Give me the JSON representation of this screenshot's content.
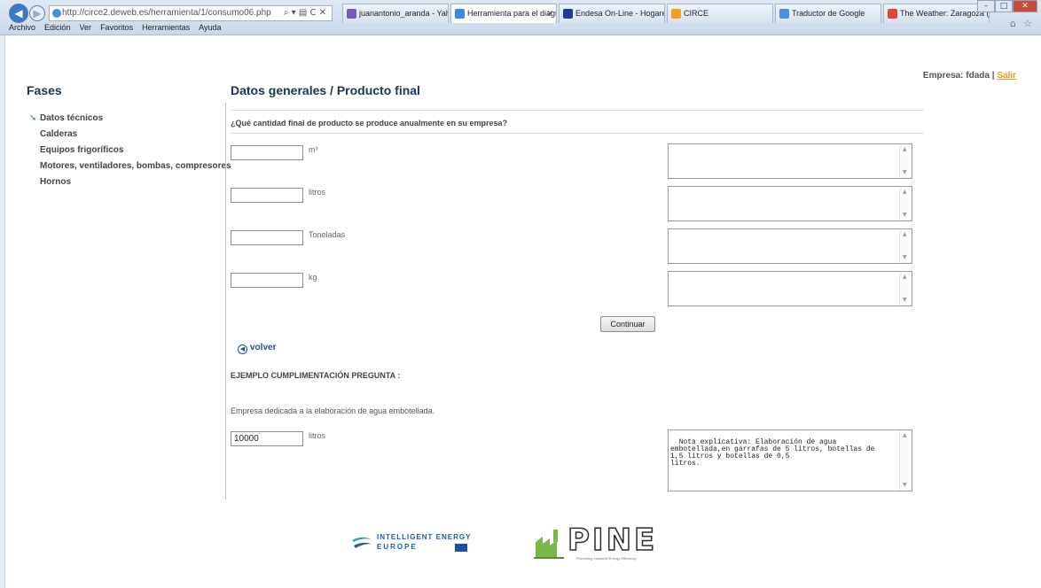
{
  "browser": {
    "url": "http://circe2.deweb.es/herramienta/1/consumo06.php",
    "addr_controls": "⌕ ▾ ▤ C ✕",
    "tabs": [
      {
        "label": "juanantonio_aranda - Yahoo! ...",
        "color": "#7b5bb8"
      },
      {
        "label": "Herramienta para el diagnó...",
        "color": "#3a8be0",
        "active": true
      },
      {
        "label": "Endesa On-Line - Hogares",
        "color": "#1c3f94"
      },
      {
        "label": "CIRCE",
        "color": "#f2a024"
      },
      {
        "label": "Traductor de Google",
        "color": "#4a90e2"
      },
      {
        "label": "The Weather: Zaragoza (Zarag...",
        "color": "#e0453a"
      }
    ],
    "menu": [
      "Archivo",
      "Edición",
      "Ver",
      "Favoritos",
      "Herramientas",
      "Ayuda"
    ]
  },
  "header": {
    "empresa_label": "Empresa: fdada |",
    "salir_label": "Salir"
  },
  "sidebar": {
    "title": "Fases",
    "items": [
      {
        "label": "Datos técnicos",
        "active": true
      },
      {
        "label": "Calderas"
      },
      {
        "label": "Equipos frigoríficos"
      },
      {
        "label": "Motores, ventiladores, bombas, compresores"
      },
      {
        "label": "Hornos"
      }
    ]
  },
  "main": {
    "title": "Datos generales / Producto final",
    "question": "¿Qué cantidad final de producto se produce anualmente en su empresa?",
    "fields": [
      {
        "value": "",
        "unit": "m³",
        "note": ""
      },
      {
        "value": "",
        "unit": "litros",
        "note": ""
      },
      {
        "value": "",
        "unit": "Toneladas",
        "note": ""
      },
      {
        "value": "",
        "unit": "kg",
        "note": ""
      }
    ],
    "continue_label": "Continuar",
    "back_label": "volver",
    "example_heading": "EJEMPLO CUMPLIMENTACIÓN PREGUNTA :",
    "example_text": "Empresa dedicada a la elaboración de agua embotellada.",
    "example_value": "10000",
    "example_unit": "litros",
    "example_note": "Nota explicativa: Elaboración de agua\nembotellada,en garrafas de 5 litros, botellas de\n1,5 litros y botellas de 0,5\nlitros."
  },
  "footer": {
    "ie_line1": "INTELLIGENT ENERGY",
    "ie_line2": "EUROPE",
    "pine_text": "PINE",
    "pine_sub": "Promoting Industrial Energy Efficiency"
  }
}
